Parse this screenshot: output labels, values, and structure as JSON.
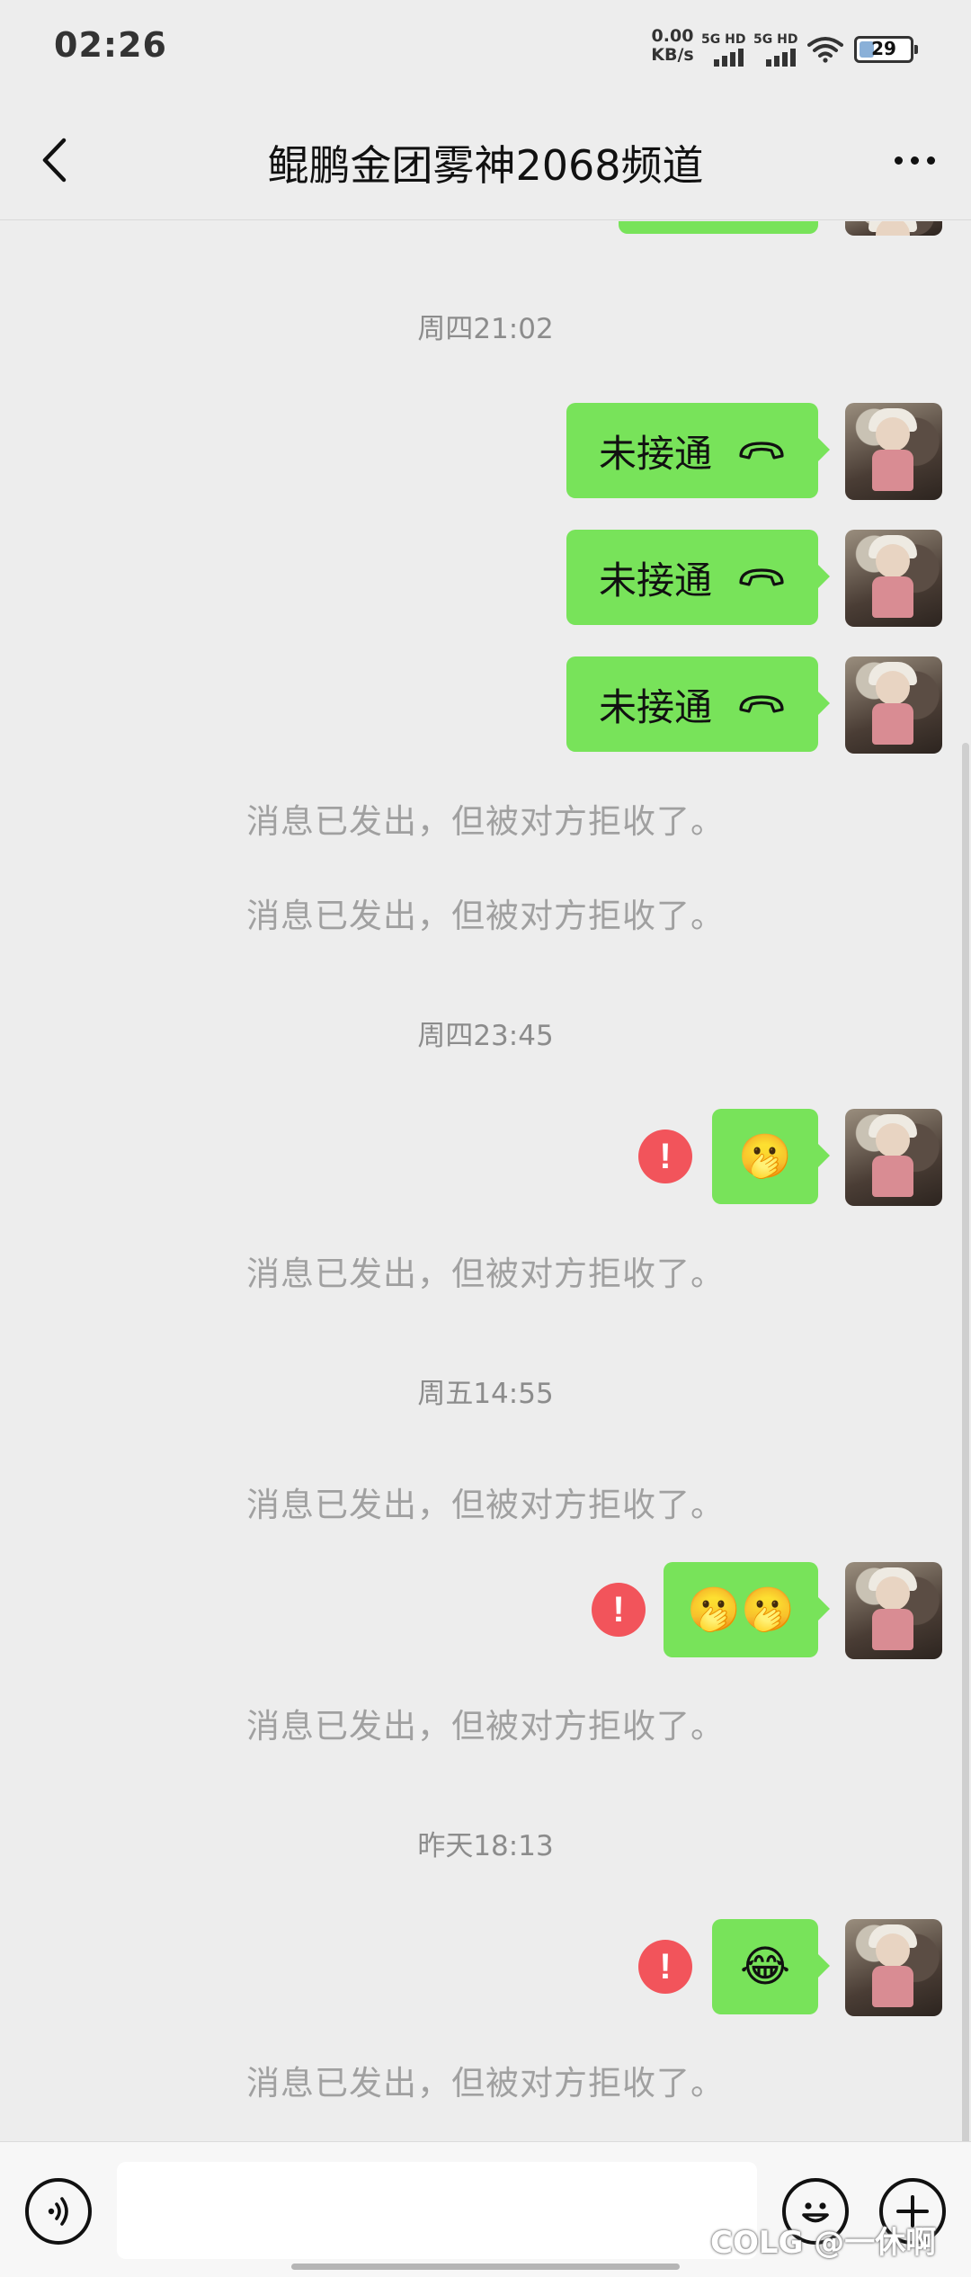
{
  "status_bar": {
    "time": "02:26",
    "net_speed_value": "0.00",
    "net_speed_unit": "KB/s",
    "sim1_label": "5G HD",
    "sim2_label": "5G HD",
    "battery_level": "29",
    "battery_fraction": 0.29,
    "battery_color": "#8ab0d8"
  },
  "header": {
    "title": "鲲鹏金团雾神2068频道",
    "back_icon": "chevron-left-icon",
    "more_icon": "more-dots-icon"
  },
  "messages": {
    "ts1": "周四21:02",
    "call1_text": "未接通",
    "call2_text": "未接通",
    "call3_text": "未接通",
    "call_icon": "hangup-phone-icon",
    "rejected1": "消息已发出，但被对方拒收了。",
    "rejected2": "消息已发出，但被对方拒收了。",
    "ts2": "周四23:45",
    "emoji1": "🫢",
    "rejected3": "消息已发出，但被对方拒收了。",
    "ts3": "周五14:55",
    "rejected4": "消息已发出，但被对方拒收了。",
    "emoji2": "🫢🫢",
    "rejected5": "消息已发出，但被对方拒收了。",
    "ts4": "昨天18:13",
    "emoji3": "😂",
    "rejected6": "消息已发出，但被对方拒收了。",
    "error_mark": "!"
  },
  "input_bar": {
    "placeholder": "",
    "voice_icon": "voice-icon",
    "emoji_icon": "emoji-icon",
    "plus_icon": "plus-icon"
  },
  "watermark": "COLG @一休啊",
  "colors": {
    "bubble": "#78e35a",
    "background": "#ededed",
    "error": "#f2545b"
  }
}
